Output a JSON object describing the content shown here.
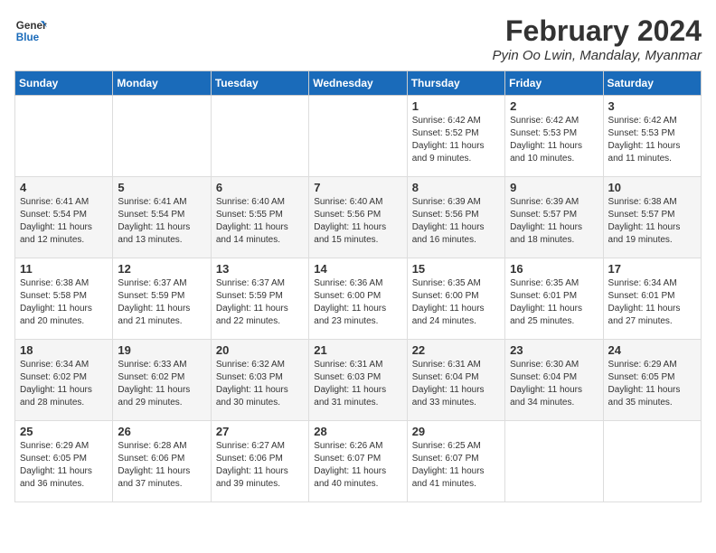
{
  "logo": {
    "line1": "General",
    "line2": "Blue"
  },
  "title": {
    "month_year": "February 2024",
    "location": "Pyin Oo Lwin, Mandalay, Myanmar"
  },
  "days_of_week": [
    "Sunday",
    "Monday",
    "Tuesday",
    "Wednesday",
    "Thursday",
    "Friday",
    "Saturday"
  ],
  "weeks": [
    [
      {
        "day": "",
        "info": ""
      },
      {
        "day": "",
        "info": ""
      },
      {
        "day": "",
        "info": ""
      },
      {
        "day": "",
        "info": ""
      },
      {
        "day": "1",
        "info": "Sunrise: 6:42 AM\nSunset: 5:52 PM\nDaylight: 11 hours\nand 9 minutes."
      },
      {
        "day": "2",
        "info": "Sunrise: 6:42 AM\nSunset: 5:53 PM\nDaylight: 11 hours\nand 10 minutes."
      },
      {
        "day": "3",
        "info": "Sunrise: 6:42 AM\nSunset: 5:53 PM\nDaylight: 11 hours\nand 11 minutes."
      }
    ],
    [
      {
        "day": "4",
        "info": "Sunrise: 6:41 AM\nSunset: 5:54 PM\nDaylight: 11 hours\nand 12 minutes."
      },
      {
        "day": "5",
        "info": "Sunrise: 6:41 AM\nSunset: 5:54 PM\nDaylight: 11 hours\nand 13 minutes."
      },
      {
        "day": "6",
        "info": "Sunrise: 6:40 AM\nSunset: 5:55 PM\nDaylight: 11 hours\nand 14 minutes."
      },
      {
        "day": "7",
        "info": "Sunrise: 6:40 AM\nSunset: 5:56 PM\nDaylight: 11 hours\nand 15 minutes."
      },
      {
        "day": "8",
        "info": "Sunrise: 6:39 AM\nSunset: 5:56 PM\nDaylight: 11 hours\nand 16 minutes."
      },
      {
        "day": "9",
        "info": "Sunrise: 6:39 AM\nSunset: 5:57 PM\nDaylight: 11 hours\nand 18 minutes."
      },
      {
        "day": "10",
        "info": "Sunrise: 6:38 AM\nSunset: 5:57 PM\nDaylight: 11 hours\nand 19 minutes."
      }
    ],
    [
      {
        "day": "11",
        "info": "Sunrise: 6:38 AM\nSunset: 5:58 PM\nDaylight: 11 hours\nand 20 minutes."
      },
      {
        "day": "12",
        "info": "Sunrise: 6:37 AM\nSunset: 5:59 PM\nDaylight: 11 hours\nand 21 minutes."
      },
      {
        "day": "13",
        "info": "Sunrise: 6:37 AM\nSunset: 5:59 PM\nDaylight: 11 hours\nand 22 minutes."
      },
      {
        "day": "14",
        "info": "Sunrise: 6:36 AM\nSunset: 6:00 PM\nDaylight: 11 hours\nand 23 minutes."
      },
      {
        "day": "15",
        "info": "Sunrise: 6:35 AM\nSunset: 6:00 PM\nDaylight: 11 hours\nand 24 minutes."
      },
      {
        "day": "16",
        "info": "Sunrise: 6:35 AM\nSunset: 6:01 PM\nDaylight: 11 hours\nand 25 minutes."
      },
      {
        "day": "17",
        "info": "Sunrise: 6:34 AM\nSunset: 6:01 PM\nDaylight: 11 hours\nand 27 minutes."
      }
    ],
    [
      {
        "day": "18",
        "info": "Sunrise: 6:34 AM\nSunset: 6:02 PM\nDaylight: 11 hours\nand 28 minutes."
      },
      {
        "day": "19",
        "info": "Sunrise: 6:33 AM\nSunset: 6:02 PM\nDaylight: 11 hours\nand 29 minutes."
      },
      {
        "day": "20",
        "info": "Sunrise: 6:32 AM\nSunset: 6:03 PM\nDaylight: 11 hours\nand 30 minutes."
      },
      {
        "day": "21",
        "info": "Sunrise: 6:31 AM\nSunset: 6:03 PM\nDaylight: 11 hours\nand 31 minutes."
      },
      {
        "day": "22",
        "info": "Sunrise: 6:31 AM\nSunset: 6:04 PM\nDaylight: 11 hours\nand 33 minutes."
      },
      {
        "day": "23",
        "info": "Sunrise: 6:30 AM\nSunset: 6:04 PM\nDaylight: 11 hours\nand 34 minutes."
      },
      {
        "day": "24",
        "info": "Sunrise: 6:29 AM\nSunset: 6:05 PM\nDaylight: 11 hours\nand 35 minutes."
      }
    ],
    [
      {
        "day": "25",
        "info": "Sunrise: 6:29 AM\nSunset: 6:05 PM\nDaylight: 11 hours\nand 36 minutes."
      },
      {
        "day": "26",
        "info": "Sunrise: 6:28 AM\nSunset: 6:06 PM\nDaylight: 11 hours\nand 37 minutes."
      },
      {
        "day": "27",
        "info": "Sunrise: 6:27 AM\nSunset: 6:06 PM\nDaylight: 11 hours\nand 39 minutes."
      },
      {
        "day": "28",
        "info": "Sunrise: 6:26 AM\nSunset: 6:07 PM\nDaylight: 11 hours\nand 40 minutes."
      },
      {
        "day": "29",
        "info": "Sunrise: 6:25 AM\nSunset: 6:07 PM\nDaylight: 11 hours\nand 41 minutes."
      },
      {
        "day": "",
        "info": ""
      },
      {
        "day": "",
        "info": ""
      }
    ]
  ]
}
